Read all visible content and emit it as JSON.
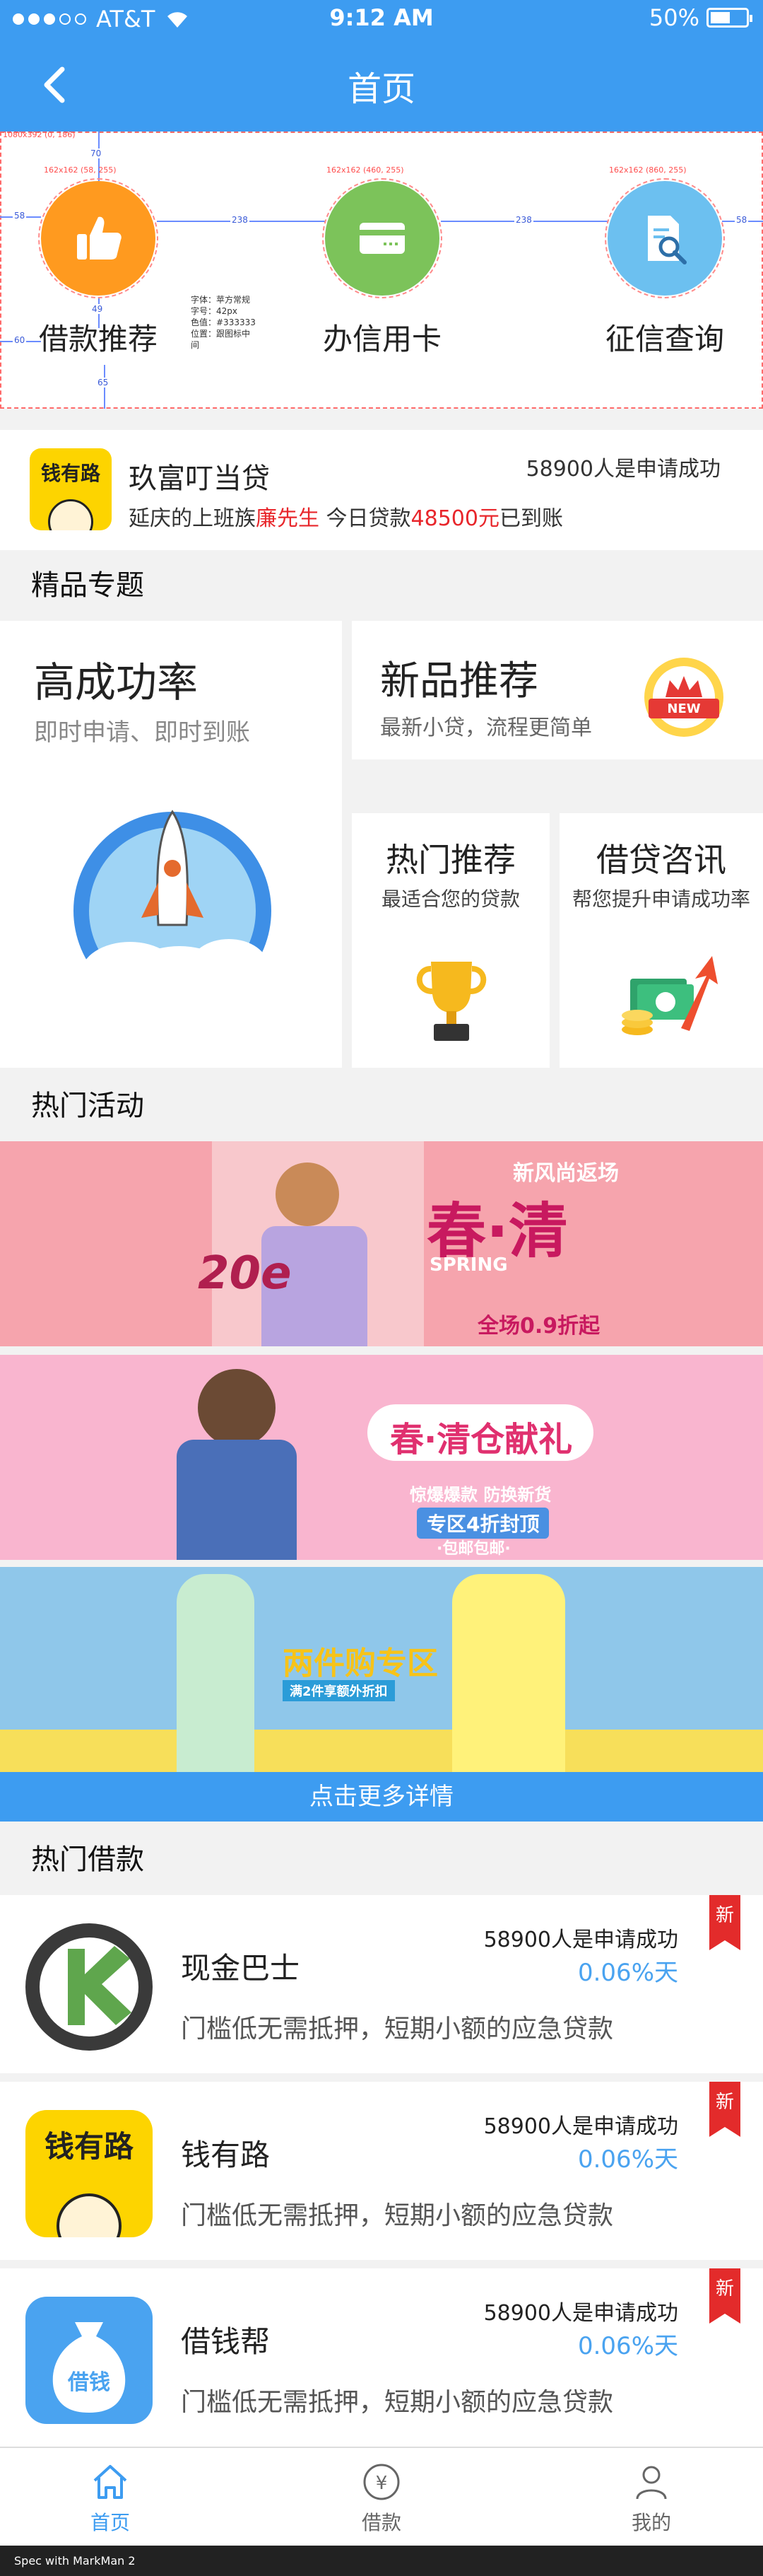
{
  "status": {
    "carrier": "AT&T",
    "time": "9:12 AM",
    "battery": "50%"
  },
  "header": {
    "title": "首页"
  },
  "spec": {
    "frame_label": "1080x392 (0, 186)",
    "icon1_label": "162x162 (58, 255)",
    "icon2_label": "162x162 (460, 255)",
    "icon3_label": "162x162 (860, 255)",
    "dim_70": "70",
    "dim_58_left": "58",
    "dim_238_a": "238",
    "dim_238_b": "238",
    "dim_58_right": "58",
    "dim_49": "49",
    "dim_60": "60",
    "dim_65": "65",
    "note": [
      "字体：苹方常规",
      "字号：42px",
      "色值：#333333",
      "位置：跟图标中",
      "间"
    ]
  },
  "categories": [
    {
      "label": "借款推荐",
      "color": "#ff9a1f",
      "icon": "thumbs-up-icon"
    },
    {
      "label": "办信用卡",
      "color": "#7cc35a",
      "icon": "credit-card-icon"
    },
    {
      "label": "征信查询",
      "color": "#6cc0f0",
      "icon": "document-search-icon"
    }
  ],
  "success": {
    "logo_text": "钱有路",
    "name": "玖富叮当贷",
    "count": "58900人是申请成功",
    "desc_prefix": "延庆的上班族",
    "desc_person": "廉先生",
    "desc_mid": "  今日贷款",
    "desc_amount": "48500元",
    "desc_suffix": "已到账"
  },
  "sections": {
    "special": "精品专题",
    "activity": "热门活动",
    "loans": "热门借款"
  },
  "special": {
    "big": {
      "title": "高成功率",
      "subtitle": "即时申请、即时到账"
    },
    "new": {
      "title": "新品推荐",
      "subtitle": "最新小贷，流程更简单",
      "badge": "NEW"
    },
    "hot": {
      "title": "热门推荐",
      "subtitle": "最适合您的贷款"
    },
    "consult": {
      "title": "借贷咨讯",
      "subtitle": "帮您提升申请成功率"
    }
  },
  "banners": [
    {
      "main": "春·清",
      "sub": "新风尚返场",
      "en": "SPRING",
      "promo": "全场0.9折起",
      "num": "20e"
    },
    {
      "main": "春·清仓献礼",
      "sub": "惊爆爆款  防换新货",
      "promo": "专区4折封顶",
      "tag": "·包邮包邮·"
    },
    {
      "main": "两件购专区",
      "sub": "满2件享额外折扣"
    }
  ],
  "more": "点击更多详情",
  "loans": [
    {
      "name": "现金巴士",
      "count": "58900人是申请成功",
      "rate": "0.06%天",
      "desc": "门槛低无需抵押，短期小额的应急贷款",
      "tag": "新",
      "icon": "cash-bus-logo"
    },
    {
      "name": "钱有路",
      "count": "58900人是申请成功",
      "rate": "0.06%天",
      "desc": "门槛低无需抵押，短期小额的应急贷款",
      "tag": "新",
      "icon": "qian-you-lu-logo",
      "logo_text": "钱有路"
    },
    {
      "name": "借钱帮",
      "count": "58900人是申请成功",
      "rate": "0.06%天",
      "desc": "门槛低无需抵押，短期小额的应急贷款",
      "tag": "新",
      "icon": "jie-qian-bang-logo",
      "logo_text": "借钱"
    }
  ],
  "tabs": [
    {
      "label": "首页",
      "icon": "home-icon",
      "active": true
    },
    {
      "label": "借款",
      "icon": "yen-icon",
      "active": false
    },
    {
      "label": "我的",
      "icon": "user-icon",
      "active": false
    }
  ],
  "footer": "Spec with MarkMan 2"
}
